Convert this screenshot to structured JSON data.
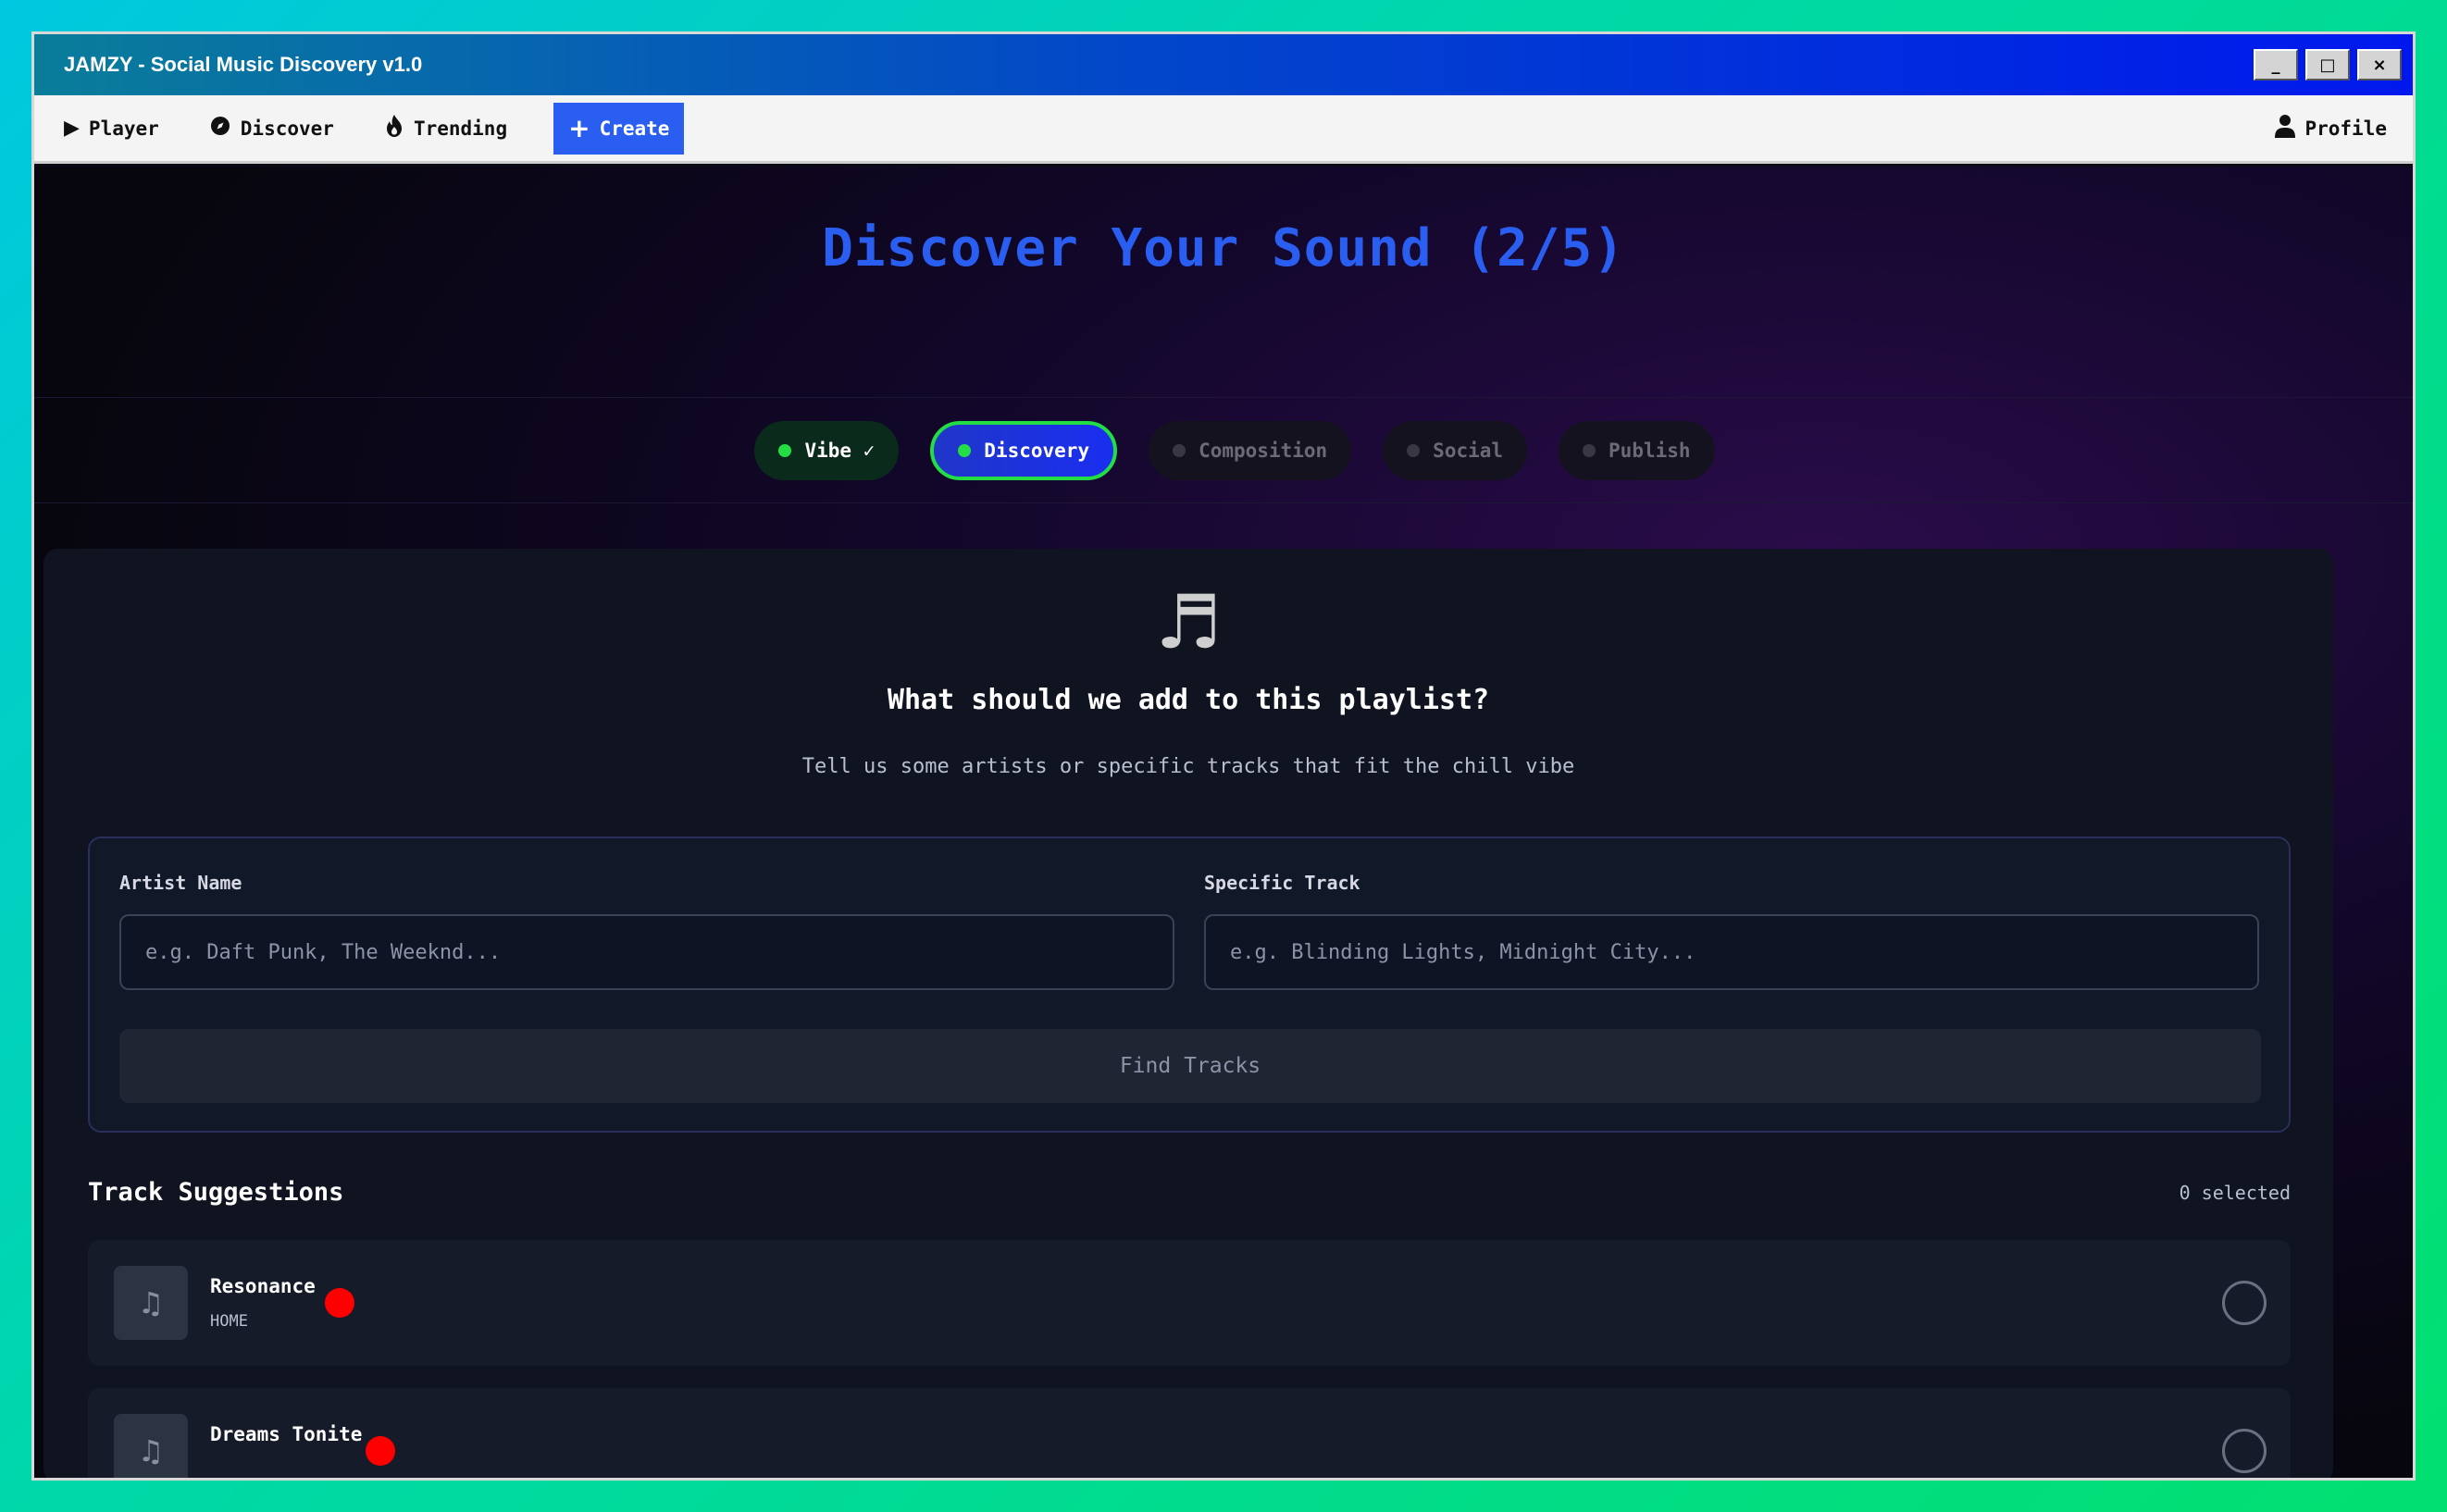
{
  "window": {
    "title": "JAMZY - Social Music Discovery v1.0"
  },
  "controls": {
    "minimize": "_",
    "maximize": "□",
    "close": "×"
  },
  "nav": {
    "player": "Player",
    "discover": "Discover",
    "trending": "Trending",
    "create": "Create",
    "profile": "Profile"
  },
  "hero": {
    "title": "Discover Your Sound (2/5)"
  },
  "steps": [
    {
      "label": "Vibe ✓",
      "state": "done"
    },
    {
      "label": "Discovery",
      "state": "active"
    },
    {
      "label": "Composition",
      "state": "pending"
    },
    {
      "label": "Social",
      "state": "pending"
    },
    {
      "label": "Publish",
      "state": "pending"
    }
  ],
  "prompt": {
    "icon": "music-note-icon",
    "heading": "What should we add to this playlist?",
    "subtext": "Tell us some artists or specific tracks that fit the chill vibe"
  },
  "form": {
    "artist_label": "Artist Name",
    "artist_placeholder": "e.g. Daft Punk, The Weeknd...",
    "artist_value": "",
    "track_label": "Specific Track",
    "track_placeholder": "e.g. Blinding Lights, Midnight City...",
    "track_value": "",
    "find_button": "Find Tracks"
  },
  "suggestions": {
    "title": "Track Suggestions",
    "selected_count": "0 selected",
    "tracks": [
      {
        "name": "Resonance",
        "artist": "HOME"
      },
      {
        "name": "Dreams Tonite",
        "artist": ""
      }
    ]
  },
  "colors": {
    "accent": "#2a5ef0",
    "success": "#22dd44",
    "record": "#ff0000"
  }
}
